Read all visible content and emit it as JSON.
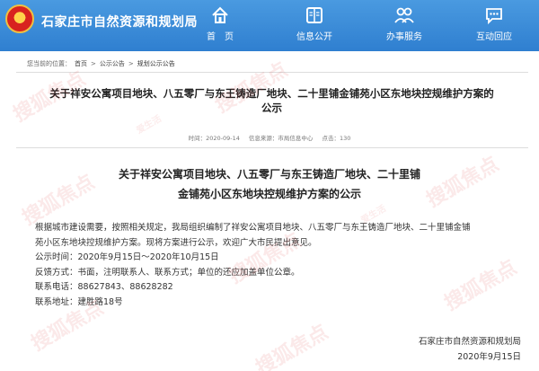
{
  "header": {
    "site_title": "石家庄市自然资源和规划局",
    "nav": [
      {
        "label": "首　页",
        "icon": "home-icon"
      },
      {
        "label": "信息公开",
        "icon": "book-icon"
      },
      {
        "label": "办事服务",
        "icon": "people-icon"
      },
      {
        "label": "互动回应",
        "icon": "chat-icon"
      }
    ]
  },
  "breadcrumb": {
    "prefix": "您当前的位置：",
    "home": "首页",
    "sep1": ">",
    "section": "公示公告",
    "sep2": ">",
    "current": "规划公示公告"
  },
  "article": {
    "title_line1": "关于祥安公寓项目地块、八五零厂与东王铸造厂地块、二十里铺金铺苑小区东地块控规维护方案的",
    "title_line2": "公示",
    "date": "时间：2020-09-14",
    "source": "信息来源：市局信息中心",
    "views": "点击：130",
    "heading_line1": "关于祥安公寓项目地块、八五零厂与东王铸造厂地块、二十里铺",
    "heading_line2": "金铺苑小区东地块控规维护方案的公示",
    "para1_line1": "根据城市建设需要，按照相关规定，我局组织编制了祥安公寓项目地块、八五零厂与东王铸造厂地块、二十里铺金铺",
    "para1_line2": "苑小区东地块控规维护方案。现将方案进行公示，欢迎广大市民提出意见。",
    "period": "公示时间：2020年9月15日～2020年10月15日",
    "feedback": "反馈方式：书面，注明联系人、联系方式；单位的还应加盖单位公章。",
    "phone": "联系电话：88627843、88628282",
    "address": "联系地址：建胜路18号",
    "sign_org": "石家庄市自然资源和规划局",
    "sign_date": "2020年9月15日"
  },
  "colors": {
    "header_bg": "#3a8ad8",
    "watermark": "#dc2828"
  }
}
